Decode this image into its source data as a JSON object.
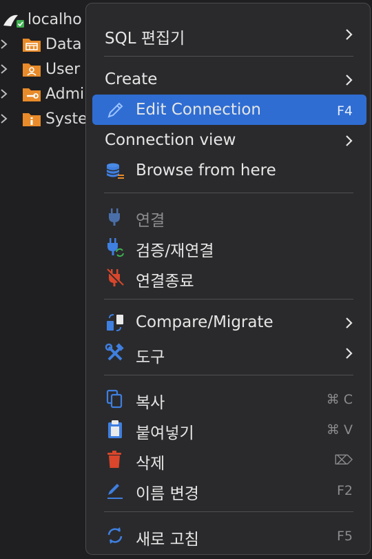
{
  "tree": {
    "root_label": "localho",
    "items": [
      {
        "label": "Data",
        "icon": "database-folder-icon"
      },
      {
        "label": "User",
        "icon": "user-folder-icon"
      },
      {
        "label": "Admi",
        "icon": "admin-wrench-folder-icon"
      },
      {
        "label": "Syste",
        "icon": "system-info-folder-icon"
      }
    ]
  },
  "menu": {
    "sql_editor": {
      "label": "SQL 편집기"
    },
    "create": {
      "label": "Create"
    },
    "edit_connection": {
      "label": "Edit Connection",
      "shortcut": "F4"
    },
    "connection_view": {
      "label": "Connection view"
    },
    "browse_from_here": {
      "label": "Browse from here"
    },
    "connect": {
      "label": "연결"
    },
    "reconnect": {
      "label": "검증/재연결"
    },
    "disconnect": {
      "label": "연결종료"
    },
    "compare_migrate": {
      "label": "Compare/Migrate"
    },
    "tools": {
      "label": "도구"
    },
    "copy": {
      "label": "복사",
      "shortcut": "⌘ C"
    },
    "paste": {
      "label": "붙여넣기",
      "shortcut": "⌘ V"
    },
    "delete": {
      "label": "삭제",
      "shortcut": "⌦"
    },
    "rename": {
      "label": "이름 변경",
      "shortcut": "F2"
    },
    "refresh": {
      "label": "새로 고침",
      "shortcut": "F5"
    }
  },
  "colors": {
    "selection": "#2f6dd3",
    "folder_orange": "#e98b2a",
    "icon_blue": "#3f7fe0",
    "disconnect_red": "#d9462b",
    "refresh_green": "#3fb050"
  }
}
